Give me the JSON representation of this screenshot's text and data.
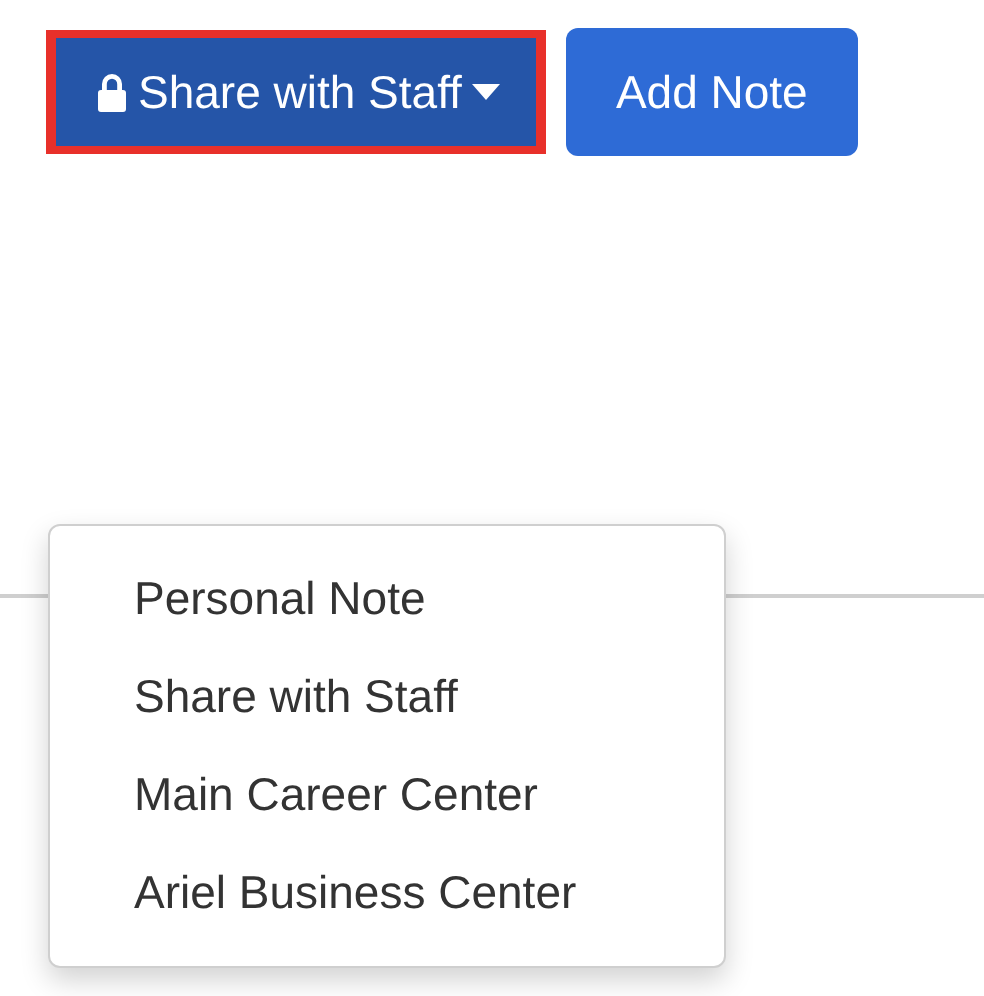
{
  "toolbar": {
    "share_button": {
      "label": "Share with Staff",
      "highlighted": true
    },
    "add_button": {
      "label": "Add Note"
    }
  },
  "dropdown_menu": {
    "open": true,
    "items": [
      {
        "label": "Personal Note"
      },
      {
        "label": "Share with Staff"
      },
      {
        "label": "Main Career Center"
      },
      {
        "label": "Ariel Business Center"
      }
    ]
  }
}
